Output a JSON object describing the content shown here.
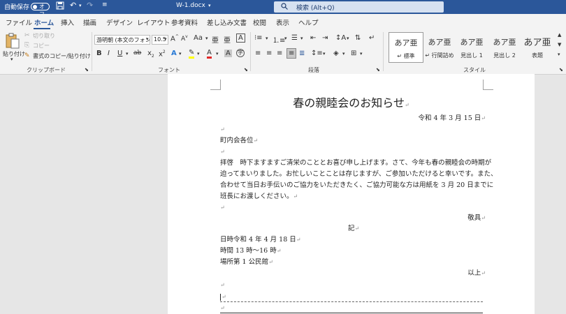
{
  "titlebar": {
    "autosave_label": "自動保存",
    "autosave_state": "オフ",
    "filename": "W-1.docx",
    "search_placeholder": "検索 (Alt+Q)"
  },
  "tabs": [
    "ファイル",
    "ホーム",
    "挿入",
    "描画",
    "デザイン",
    "レイアウト",
    "参考資料",
    "差し込み文書",
    "校閲",
    "表示",
    "ヘルプ"
  ],
  "active_tab": "ホーム",
  "ribbon": {
    "clipboard": {
      "paste": "貼り付け",
      "cut": "切り取り",
      "copy": "コピー",
      "format_painter": "書式のコピー/貼り付け",
      "label": "クリップボード"
    },
    "font": {
      "font_name": "游明朝 (本文のフォン",
      "font_size": "10.5",
      "label": "フォント"
    },
    "paragraph": {
      "label": "段落"
    },
    "styles": {
      "items": [
        {
          "sample": "あア亜",
          "name": "↵ 標準"
        },
        {
          "sample": "あア亜",
          "name": "↵ 行間詰め"
        },
        {
          "sample": "あア亜",
          "name": "見出し 1"
        },
        {
          "sample": "あア亜",
          "name": "見出し 2"
        },
        {
          "sample": "あア亜",
          "name": "表題"
        }
      ],
      "label": "スタイル"
    }
  },
  "document": {
    "title": "春の親睦会のお知らせ",
    "date": "令和 4 年 3 月 15 日",
    "recipient": "町内会各位",
    "body": [
      "拝啓　時下ますますご清栄のこととお喜び申し上げます。さて、今年も春の親睦会の時期が",
      "迫ってまいりました。お忙しいことことは存じますが、ご参加いただけると幸いです。また、",
      "合わせて当日お手伝いのご協力をいただきたく、ご協力可能な方は用紙を 3 月 20 日までに",
      "班長にお渡しください。"
    ],
    "closing": "敬具",
    "ki": "記",
    "details": [
      "日時令和 4 年 4 月 18 日",
      "時間 13 時～16 時",
      "場所第 1 公民館"
    ],
    "ijou": "以上",
    "para_mark": "↵"
  }
}
